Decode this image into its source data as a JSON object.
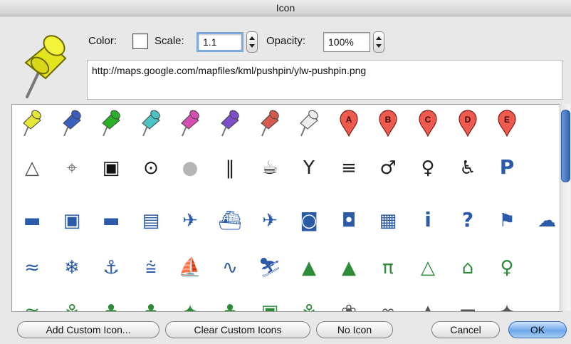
{
  "window": {
    "title": "Icon"
  },
  "toolbar": {
    "color_label": "Color:",
    "scale_label": "Scale:",
    "scale_value": "1.1",
    "opacity_label": "Opacity:",
    "opacity_value": "100%"
  },
  "icon_url": "http://maps.google.com/mapfiles/kml/pushpin/ylw-pushpin.png",
  "grid": {
    "rows": [
      [
        {
          "name": "yellow-pushpin-icon",
          "kind": "pin",
          "color": "#e6e634"
        },
        {
          "name": "blue-pushpin-icon",
          "kind": "pin",
          "color": "#3a5fbf"
        },
        {
          "name": "green-pushpin-icon",
          "kind": "pin",
          "color": "#29b229"
        },
        {
          "name": "light-blue-pushpin-icon",
          "kind": "pin",
          "color": "#4cc4c4"
        },
        {
          "name": "pink-pushpin-icon",
          "kind": "pin",
          "color": "#d64fb0"
        },
        {
          "name": "purple-pushpin-icon",
          "kind": "pin",
          "color": "#7f4fc9"
        },
        {
          "name": "red-pushpin-icon",
          "kind": "pin",
          "color": "#d65a4f"
        },
        {
          "name": "white-pushpin-icon",
          "kind": "pin",
          "color": "#eeeeee"
        },
        {
          "name": "marker-a-icon",
          "kind": "marker",
          "letter": "A",
          "color": "#ef5a4f"
        },
        {
          "name": "marker-b-icon",
          "kind": "marker",
          "letter": "B",
          "color": "#ef5a4f"
        },
        {
          "name": "marker-c-icon",
          "kind": "marker",
          "letter": "C",
          "color": "#ef5a4f"
        },
        {
          "name": "marker-d-icon",
          "kind": "marker",
          "letter": "D",
          "color": "#ef5a4f"
        },
        {
          "name": "marker-e-icon",
          "kind": "marker",
          "letter": "E",
          "color": "#ef5a4f"
        }
      ],
      [
        {
          "name": "triangle-icon",
          "kind": "glyph",
          "glyph": "△",
          "color": "#555555"
        },
        {
          "name": "target-dotted-icon",
          "kind": "glyph",
          "glyph": "⌖",
          "color": "#777777"
        },
        {
          "name": "square-dot-icon",
          "kind": "glyph",
          "glyph": "▣",
          "color": "#111111"
        },
        {
          "name": "circle-dot-icon",
          "kind": "glyph",
          "glyph": "⊙",
          "color": "#111111"
        },
        {
          "name": "gray-dot-icon",
          "kind": "glyph",
          "glyph": "●",
          "color": "#b5b5b5"
        },
        {
          "name": "dining-icon",
          "kind": "glyph",
          "glyph": "‖",
          "color": "#222222"
        },
        {
          "name": "coffee-icon",
          "kind": "glyph",
          "glyph": "☕",
          "color": "#222222"
        },
        {
          "name": "bar-icon",
          "kind": "glyph",
          "glyph": "Y",
          "color": "#222222"
        },
        {
          "name": "snack-bar-icon",
          "kind": "glyph",
          "glyph": "≡",
          "color": "#222222"
        },
        {
          "name": "man-icon",
          "kind": "glyph",
          "glyph": "♂",
          "color": "#222222"
        },
        {
          "name": "woman-icon",
          "kind": "glyph",
          "glyph": "♀",
          "color": "#222222"
        },
        {
          "name": "wheelchair-icon",
          "kind": "glyph",
          "glyph": "♿",
          "color": "#222222"
        },
        {
          "name": "parking-icon",
          "kind": "text",
          "glyph": "P",
          "color": "#2b5aa8"
        }
      ],
      [
        {
          "name": "taxi-icon",
          "kind": "glyph",
          "glyph": "▬",
          "color": "#2b5aa8"
        },
        {
          "name": "bus-icon",
          "kind": "glyph",
          "glyph": "▣",
          "color": "#2b5aa8"
        },
        {
          "name": "truck-icon",
          "kind": "glyph",
          "glyph": "▬",
          "color": "#2b5aa8"
        },
        {
          "name": "rail-icon",
          "kind": "glyph",
          "glyph": "▤",
          "color": "#2b5aa8"
        },
        {
          "name": "airport-icon",
          "kind": "glyph",
          "glyph": "✈",
          "color": "#2b5aa8"
        },
        {
          "name": "ferry-icon",
          "kind": "glyph",
          "glyph": "⛴",
          "color": "#2b5aa8"
        },
        {
          "name": "heliport-icon",
          "kind": "glyph",
          "glyph": "✈",
          "color": "#2b5aa8"
        },
        {
          "name": "subway-icon",
          "kind": "glyph",
          "glyph": "◙",
          "color": "#2b5aa8"
        },
        {
          "name": "tram-icon",
          "kind": "glyph",
          "glyph": "◘",
          "color": "#2b5aa8"
        },
        {
          "name": "cable-car-icon",
          "kind": "glyph",
          "glyph": "▦",
          "color": "#2b5aa8"
        },
        {
          "name": "info-icon",
          "kind": "text",
          "glyph": "i",
          "color": "#2b5aa8"
        },
        {
          "name": "help-icon",
          "kind": "text",
          "glyph": "?",
          "color": "#2b5aa8"
        },
        {
          "name": "flag-icon",
          "kind": "glyph",
          "glyph": "⚑",
          "color": "#2b5aa8"
        },
        {
          "name": "snow-shower-icon",
          "kind": "glyph",
          "glyph": "☁",
          "color": "#2b5aa8"
        }
      ],
      [
        {
          "name": "water-icon",
          "kind": "glyph",
          "glyph": "≈",
          "color": "#2b5aa8"
        },
        {
          "name": "snowflake-icon",
          "kind": "glyph",
          "glyph": "❄",
          "color": "#2b5aa8"
        },
        {
          "name": "anchor-icon",
          "kind": "glyph",
          "glyph": "⚓",
          "color": "#2b5aa8"
        },
        {
          "name": "fishing-icon",
          "kind": "glyph",
          "glyph": "⩭",
          "color": "#2b5aa8"
        },
        {
          "name": "sailing-icon",
          "kind": "glyph",
          "glyph": "⛵",
          "color": "#2b5aa8"
        },
        {
          "name": "swimming-icon",
          "kind": "glyph",
          "glyph": "∿",
          "color": "#2b5aa8"
        },
        {
          "name": "skiing-icon",
          "kind": "glyph",
          "glyph": "⛷",
          "color": "#2b5aa8"
        },
        {
          "name": "tree-icon",
          "kind": "glyph",
          "glyph": "▲",
          "color": "#2e8b3a"
        },
        {
          "name": "campfire-icon",
          "kind": "glyph",
          "glyph": "▲",
          "color": "#2e8b3a"
        },
        {
          "name": "picnic-icon",
          "kind": "glyph",
          "glyph": "π",
          "color": "#2e8b3a"
        },
        {
          "name": "campground-icon",
          "kind": "glyph",
          "glyph": "△",
          "color": "#2e8b3a"
        },
        {
          "name": "ranger-station-icon",
          "kind": "glyph",
          "glyph": "⌂",
          "color": "#2e8b3a"
        },
        {
          "name": "toilets-icon",
          "kind": "glyph",
          "glyph": "♀",
          "color": "#2e8b3a"
        }
      ],
      [
        {
          "name": "partial-icon-1",
          "kind": "glyph",
          "glyph": "≈",
          "color": "#2e8b3a"
        },
        {
          "name": "partial-icon-2",
          "kind": "glyph",
          "glyph": "⚘",
          "color": "#2e8b3a"
        },
        {
          "name": "partial-icon-3",
          "kind": "glyph",
          "glyph": "♣",
          "color": "#2e8b3a"
        },
        {
          "name": "partial-icon-4",
          "kind": "glyph",
          "glyph": "♣",
          "color": "#2e8b3a"
        },
        {
          "name": "partial-icon-5",
          "kind": "glyph",
          "glyph": "✦",
          "color": "#2e8b3a"
        },
        {
          "name": "partial-icon-6",
          "kind": "glyph",
          "glyph": "♣",
          "color": "#2e8b3a"
        },
        {
          "name": "partial-icon-7",
          "kind": "glyph",
          "glyph": "▣",
          "color": "#2e8b3a"
        },
        {
          "name": "partial-icon-8",
          "kind": "glyph",
          "glyph": "⚘",
          "color": "#2e8b3a"
        },
        {
          "name": "partial-icon-9",
          "kind": "glyph",
          "glyph": "❀",
          "color": "#555555"
        },
        {
          "name": "partial-icon-10",
          "kind": "glyph",
          "glyph": "∞",
          "color": "#555555"
        },
        {
          "name": "partial-icon-11",
          "kind": "glyph",
          "glyph": "▲",
          "color": "#555555"
        },
        {
          "name": "partial-icon-12",
          "kind": "glyph",
          "glyph": "▬",
          "color": "#555555"
        },
        {
          "name": "partial-icon-13",
          "kind": "glyph",
          "glyph": "✦",
          "color": "#555555"
        }
      ]
    ]
  },
  "buttons": {
    "add_custom": "Add Custom Icon...",
    "clear_custom": "Clear Custom Icons",
    "no_icon": "No Icon",
    "cancel": "Cancel",
    "ok": "OK"
  }
}
